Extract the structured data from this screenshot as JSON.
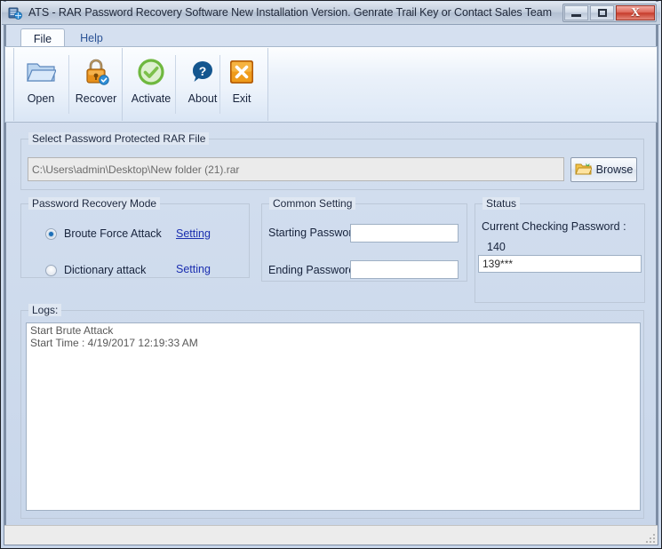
{
  "window": {
    "title": "ATS - RAR Password Recovery Software New Installation Version. Genrate Trail Key or Contact Sales Team",
    "app_icon": "app-icon",
    "controls": {
      "minimize": "minimize-button",
      "maximize": "maximize-button",
      "close_glyph": "X"
    }
  },
  "tabs": [
    {
      "label": "File",
      "active": true
    },
    {
      "label": "Help",
      "active": false
    }
  ],
  "toolbar": {
    "buttons": [
      {
        "label": "Open",
        "icon": "open-folder-icon"
      },
      {
        "label": "Recover",
        "icon": "lock-icon"
      },
      {
        "label": "Activate",
        "icon": "green-check-icon"
      },
      {
        "label": "About",
        "icon": "question-mark-icon"
      },
      {
        "label": "Exit",
        "icon": "orange-x-icon"
      }
    ]
  },
  "file_section": {
    "caption": "Select Password Protected RAR File",
    "path_value": "C:\\Users\\admin\\Desktop\\New folder (21).rar",
    "path_placeholder": "",
    "browse_label": "Browse",
    "browse_icon": "yellow-folder-icon"
  },
  "recovery_mode": {
    "caption": "Password Recovery Mode",
    "options": [
      {
        "label": "Broute Force Attack",
        "selected": true,
        "setting_label": "Setting",
        "setting_underlined": true
      },
      {
        "label": "Dictionary attack",
        "selected": false,
        "setting_label": "Setting",
        "setting_underlined": false
      }
    ]
  },
  "common_setting": {
    "caption": "Common Setting",
    "starting_label": "Starting Password :",
    "starting_value": "",
    "ending_label": "Ending Password :",
    "ending_value": ""
  },
  "status_panel": {
    "caption": "Status",
    "current_label": "Current Checking Password :",
    "counter": "140",
    "current_value": "139***"
  },
  "logs": {
    "caption": "Logs:",
    "text": "Start Brute Attack\nStart Time : 4/19/2017 12:19:33 AM"
  },
  "statusbar": {
    "grip": "resize-grip"
  },
  "colors": {
    "accent_blue": "#1d6fb8",
    "link_blue": "#1b2fb0",
    "close_red": "#c63c2c",
    "exit_orange": "#e07d12",
    "activate_green": "#54b23a"
  }
}
